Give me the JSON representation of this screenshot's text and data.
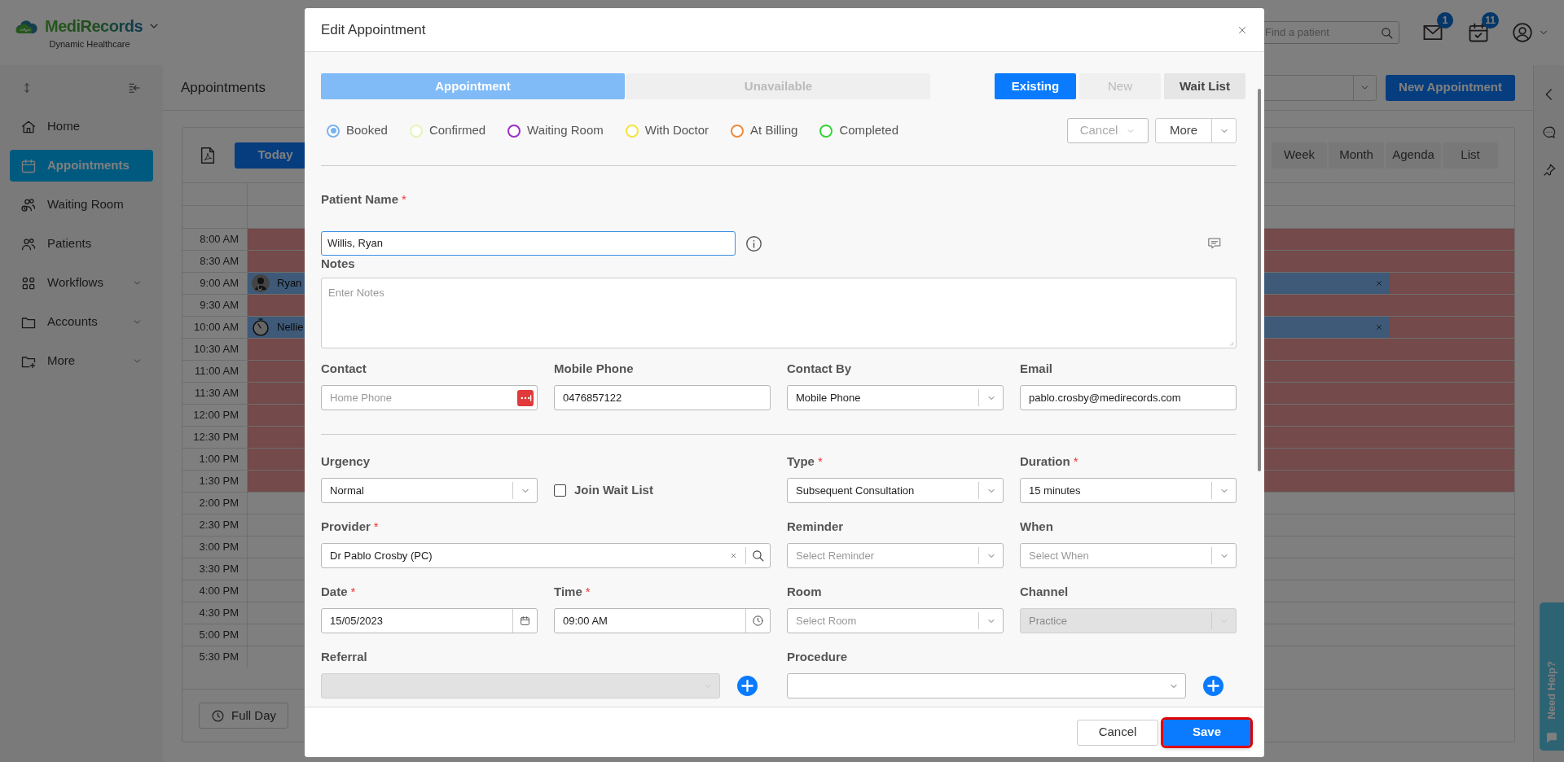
{
  "header": {
    "brand": "MediRecords",
    "subtitle": "Dynamic Healthcare",
    "search": {
      "placeholder": "Find a patient"
    },
    "badges": [
      {
        "kind": "mail",
        "count": "1"
      },
      {
        "kind": "tasks",
        "count": "11"
      }
    ]
  },
  "sidebar": {
    "items": [
      {
        "label": "Home",
        "kind": "home",
        "selected": false,
        "expandable": false
      },
      {
        "label": "Appointments",
        "kind": "calendar",
        "selected": true,
        "expandable": false
      },
      {
        "label": "Waiting Room",
        "kind": "waiting",
        "selected": false,
        "expandable": false
      },
      {
        "label": "Patients",
        "kind": "people",
        "selected": false,
        "expandable": false
      },
      {
        "label": "Workflows",
        "kind": "workflow",
        "selected": false,
        "expandable": true
      },
      {
        "label": "Accounts",
        "kind": "folder",
        "selected": false,
        "expandable": true
      },
      {
        "label": "More",
        "kind": "folder-plus",
        "selected": false,
        "expandable": true
      }
    ]
  },
  "page": {
    "title": "Appointments",
    "new_button": "New Appointment"
  },
  "calendar": {
    "today": "Today",
    "views": [
      {
        "label": "Week",
        "selected": false
      },
      {
        "label": "Month",
        "selected": false
      },
      {
        "label": "Agenda",
        "selected": false
      },
      {
        "label": "List",
        "selected": false
      }
    ],
    "slots": [
      {
        "time": "8:00 AM",
        "blocked": true
      },
      {
        "time": "8:30 AM",
        "blocked": true
      },
      {
        "time": "9:00 AM",
        "blocked": true,
        "event": {
          "name": "Ryan",
          "kind": "patient"
        }
      },
      {
        "time": "9:30 AM",
        "blocked": true
      },
      {
        "time": "10:00 AM",
        "blocked": true,
        "event": {
          "name": "Nellie",
          "kind": "timer"
        }
      },
      {
        "time": "10:30 AM",
        "blocked": true
      },
      {
        "time": "11:00 AM",
        "blocked": true
      },
      {
        "time": "11:30 AM",
        "blocked": true
      },
      {
        "time": "12:00 PM",
        "blocked": true
      },
      {
        "time": "12:30 PM",
        "blocked": true
      },
      {
        "time": "1:00 PM",
        "blocked": true
      },
      {
        "time": "1:30 PM",
        "blocked": true
      },
      {
        "time": "2:00 PM",
        "blocked": false
      },
      {
        "time": "2:30 PM",
        "blocked": false
      },
      {
        "time": "3:00 PM",
        "blocked": false
      },
      {
        "time": "3:30 PM",
        "blocked": false
      },
      {
        "time": "4:00 PM",
        "blocked": false
      },
      {
        "time": "4:30 PM",
        "blocked": false
      },
      {
        "time": "5:00 PM",
        "blocked": false
      },
      {
        "time": "5:30 PM",
        "blocked": false
      }
    ],
    "full_day": "Full Day"
  },
  "help": "Need Help?",
  "modal": {
    "title": "Edit Appointment",
    "mode_tabs": [
      {
        "label": "Appointment",
        "selected": true
      },
      {
        "label": "Unavailable",
        "selected": false
      }
    ],
    "patient_tabs": [
      {
        "label": "Existing",
        "selected": true,
        "disabled": false
      },
      {
        "label": "New",
        "selected": false,
        "disabled": true
      },
      {
        "label": "Wait List",
        "selected": false,
        "disabled": false
      }
    ],
    "statuses": [
      {
        "label": "Booked",
        "color": "#7ab2f0",
        "selected": true
      },
      {
        "label": "Confirmed",
        "color": "#e2f5b8",
        "selected": false
      },
      {
        "label": "Waiting Room",
        "color": "#9b30c8",
        "selected": false
      },
      {
        "label": "With Doctor",
        "color": "#f2e43c",
        "selected": false
      },
      {
        "label": "At Billing",
        "color": "#f08a3c",
        "selected": false
      },
      {
        "label": "Completed",
        "color": "#35d435",
        "selected": false
      }
    ],
    "actions": [
      {
        "label": "Cancel",
        "kind": "dropdown",
        "disabled": true
      },
      {
        "label": "More",
        "kind": "split",
        "disabled": false
      }
    ],
    "patient": {
      "label": "Patient Name",
      "required_mark": "*",
      "value": "Willis, Ryan"
    },
    "notes": {
      "label": "Notes",
      "placeholder": "Enter Notes"
    },
    "contact_fields": [
      {
        "label": "Contact",
        "kind": "phone",
        "placeholder": "Home Phone",
        "disabled": false
      },
      {
        "label": "Mobile Phone",
        "kind": "text",
        "value": "0476857122",
        "disabled": false
      },
      {
        "label": "Contact By",
        "kind": "select",
        "value": "Mobile Phone",
        "disabled": false
      },
      {
        "label": "Email",
        "kind": "text",
        "value": "pablo.crosby@medirecords.com",
        "disabled": false
      }
    ],
    "booking_fields": [
      {
        "label": "Urgency",
        "kind": "select",
        "value": "Normal",
        "disabled": false
      },
      {
        "label": "Join Wait List",
        "kind": "checkbox",
        "checked": false
      },
      {
        "label": "Type",
        "required_mark": "*",
        "kind": "select",
        "value": "Subsequent Consultation",
        "disabled": false
      },
      {
        "label": "Duration",
        "required_mark": "*",
        "kind": "select",
        "value": "15 minutes",
        "disabled": false
      },
      {
        "label": "Provider",
        "required_mark": "*",
        "kind": "lookup",
        "value": "Dr Pablo Crosby (PC)",
        "disabled": false
      },
      {
        "label": "Reminder",
        "kind": "select",
        "placeholder": "Select Reminder",
        "disabled": false
      },
      {
        "label": "When",
        "kind": "select",
        "placeholder": "Select When",
        "disabled": false
      },
      {
        "label": "Date",
        "required_mark": "*",
        "kind": "date",
        "value": "15/05/2023",
        "disabled": false
      },
      {
        "label": "Time",
        "required_mark": "*",
        "kind": "time",
        "value": "09:00 AM",
        "disabled": false
      },
      {
        "label": "Room",
        "kind": "select",
        "placeholder": "Select Room",
        "disabled": false
      },
      {
        "label": "Channel",
        "kind": "select",
        "value": "Practice",
        "disabled": true
      },
      {
        "label": "Referral",
        "kind": "select-add",
        "disabled": true
      },
      {
        "label": "Procedure",
        "kind": "select-add",
        "disabled": false
      }
    ],
    "buttons": [
      {
        "label": "Cancel",
        "kind": "secondary",
        "highlighted": false
      },
      {
        "label": "Save",
        "kind": "primary",
        "highlighted": true
      }
    ]
  }
}
